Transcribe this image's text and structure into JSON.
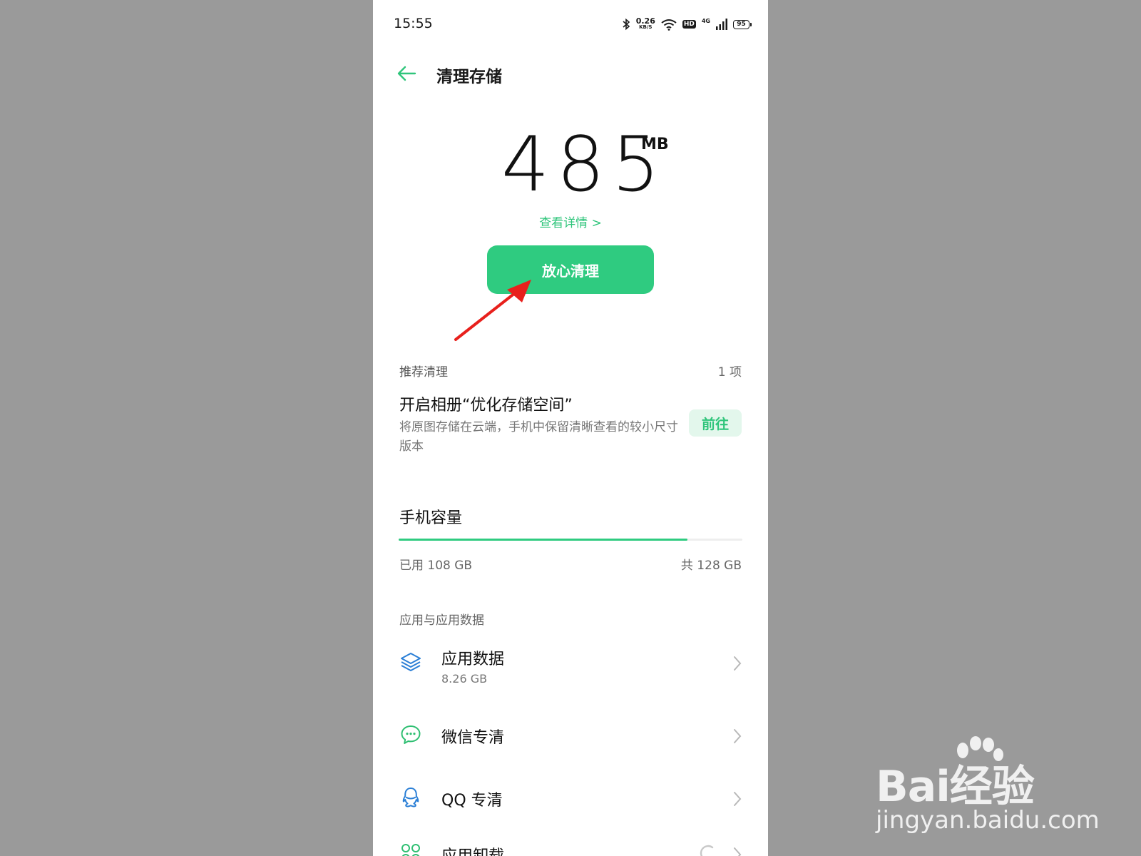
{
  "status_bar": {
    "time": "15:55",
    "net_speed_value": "0.26",
    "net_speed_unit": "KB/S",
    "hd_label": "HD",
    "net_type": "4G",
    "battery": "95"
  },
  "header": {
    "title": "清理存储"
  },
  "summary": {
    "size_value": "485",
    "size_unit": "MB",
    "details_link": "查看详情 >",
    "clean_button": "放心清理"
  },
  "recommend": {
    "section_title": "推荐清理",
    "count": "1 项",
    "item_title": "开启相册“优化存储空间”",
    "item_desc": "将原图存储在云端，手机中保留清晰查看的较小尺寸版本",
    "go_button": "前往"
  },
  "capacity": {
    "title": "手机容量",
    "used_label": "已用 108 GB",
    "total_label": "共 128 GB",
    "used_fraction": 0.84
  },
  "apps": {
    "section_title": "应用与应用数据",
    "items": [
      {
        "label": "应用数据",
        "sub": "8.26 GB",
        "icon": "layers-icon"
      },
      {
        "label": "微信专清",
        "icon": "wechat-icon"
      },
      {
        "label": "QQ 专清",
        "icon": "qq-icon"
      },
      {
        "label": "应用卸载",
        "icon": "app-grid-icon"
      }
    ]
  },
  "watermark": {
    "logo": "Bai经验",
    "url": "jingyan.baidu.com"
  },
  "colors": {
    "accent": "#2fcb80",
    "accent_light": "#e3f7ec",
    "annotation_arrow": "#e8201c"
  }
}
